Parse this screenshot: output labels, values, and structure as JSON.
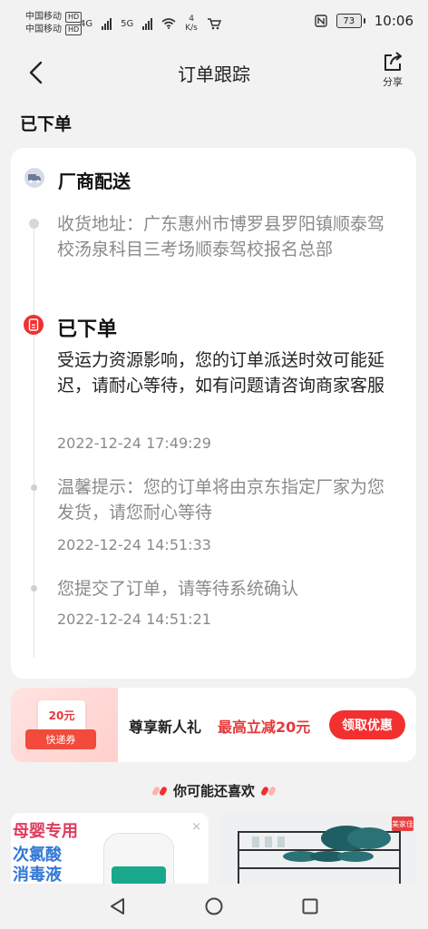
{
  "status_bar": {
    "carrier_1": "中国移动",
    "carrier_2": "中国移动",
    "hd": "HD",
    "network_type": "4G",
    "network_type_2": "5G",
    "speed_value": "4",
    "speed_unit": "K/s",
    "battery": "73",
    "time": "10:06"
  },
  "header": {
    "title": "订单跟踪",
    "share_label": "分享"
  },
  "order_status_title": "已下单",
  "tracking": {
    "delivery_title": "厂商配送",
    "address": "收货地址：广东惠州市博罗县罗阳镇顺泰驾校汤泉科目三考场顺泰驾校报名总部",
    "ordered_title": "已下单",
    "events": [
      {
        "text": "受运力资源影响，您的订单派送时效可能延迟，请耐心等待，如有问题请咨询商家客服",
        "time": "2022-12-24 17:49:29"
      },
      {
        "text": "温馨提示：您的订单将由京东指定厂家为您发货，请您耐心等待",
        "time": "2022-12-24 14:51:33"
      },
      {
        "text": "您提交了订单，请等待系统确认",
        "time": "2022-12-24 14:51:21"
      }
    ]
  },
  "coupon": {
    "amount": "20元",
    "ticket": "快递券",
    "title": "尊享新人礼",
    "highlight": "最高立减20元",
    "button": "领取优惠"
  },
  "recommend": {
    "heading": "你可能还喜欢",
    "products": [
      {
        "promo": "母婴专用",
        "line_1": "次氯酸",
        "line_2": "消毒液",
        "close": "×"
      },
      {
        "badge": "美家佳"
      }
    ]
  },
  "colors": {
    "accent_red": "#f23030",
    "coupon_red": "#e4393c",
    "text_gray": "#8a8a8a"
  },
  "icons": {
    "back": "back-arrow-icon",
    "share": "share-icon",
    "delivery": "truck-icon",
    "ordered": "order-icon",
    "nav_back": "nav-back-icon",
    "nav_home": "nav-home-icon",
    "nav_recent": "nav-recent-icon"
  }
}
